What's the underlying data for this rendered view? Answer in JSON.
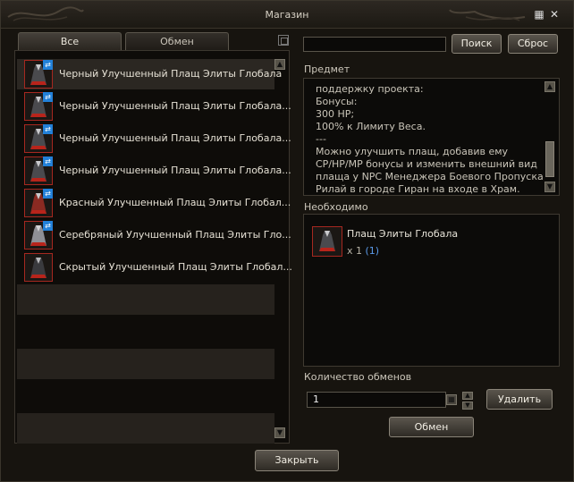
{
  "window": {
    "title": "Магазин"
  },
  "tabs": [
    {
      "label": "Все",
      "active": true
    },
    {
      "label": "Обмен",
      "active": false
    }
  ],
  "items": [
    {
      "name": "Черный Улучшенный Плащ Элиты Глобала",
      "selected": true
    },
    {
      "name": "Черный Улучшенный Плащ Элиты Глобала..."
    },
    {
      "name": "Черный Улучшенный Плащ Элиты Глобала..."
    },
    {
      "name": "Черный Улучшенный Плащ Элиты Глобала..."
    },
    {
      "name": "Красный Улучшенный Плащ Элиты Глобал..."
    },
    {
      "name": "Серебряный Улучшенный Плащ Элиты Гло..."
    },
    {
      "name": "Скрытый Улучшенный Плащ Элиты Глобал..."
    }
  ],
  "search": {
    "value": "",
    "search_label": "Поиск",
    "reset_label": "Сброс"
  },
  "item_info": {
    "label": "Предмет",
    "description": "поддержку проекта:\nБонусы:\n300 HP;\n100% к Лимиту Веса.\n---\nМожно улучшить плащ, добавив ему CP/HP/MP бонусы и изменить внешний вид плаща у NPC Менеджера Боевого Пропуска Рилай в городе Гиран на входе в Храм."
  },
  "required": {
    "label": "Необходимо",
    "item_name": "Плащ Элиты Глобала",
    "qty_text": "x 1",
    "owned_text": "(1)"
  },
  "exchange": {
    "count_label": "Количество обменов",
    "count_value": "1",
    "delete_label": "Удалить",
    "exchange_label": "Обмен"
  },
  "footer": {
    "close_label": "Закрыть"
  },
  "colors": {
    "accent_blue": "#2280d8",
    "cloak_red": "#a62820",
    "owned_count": "#5b9bea"
  }
}
